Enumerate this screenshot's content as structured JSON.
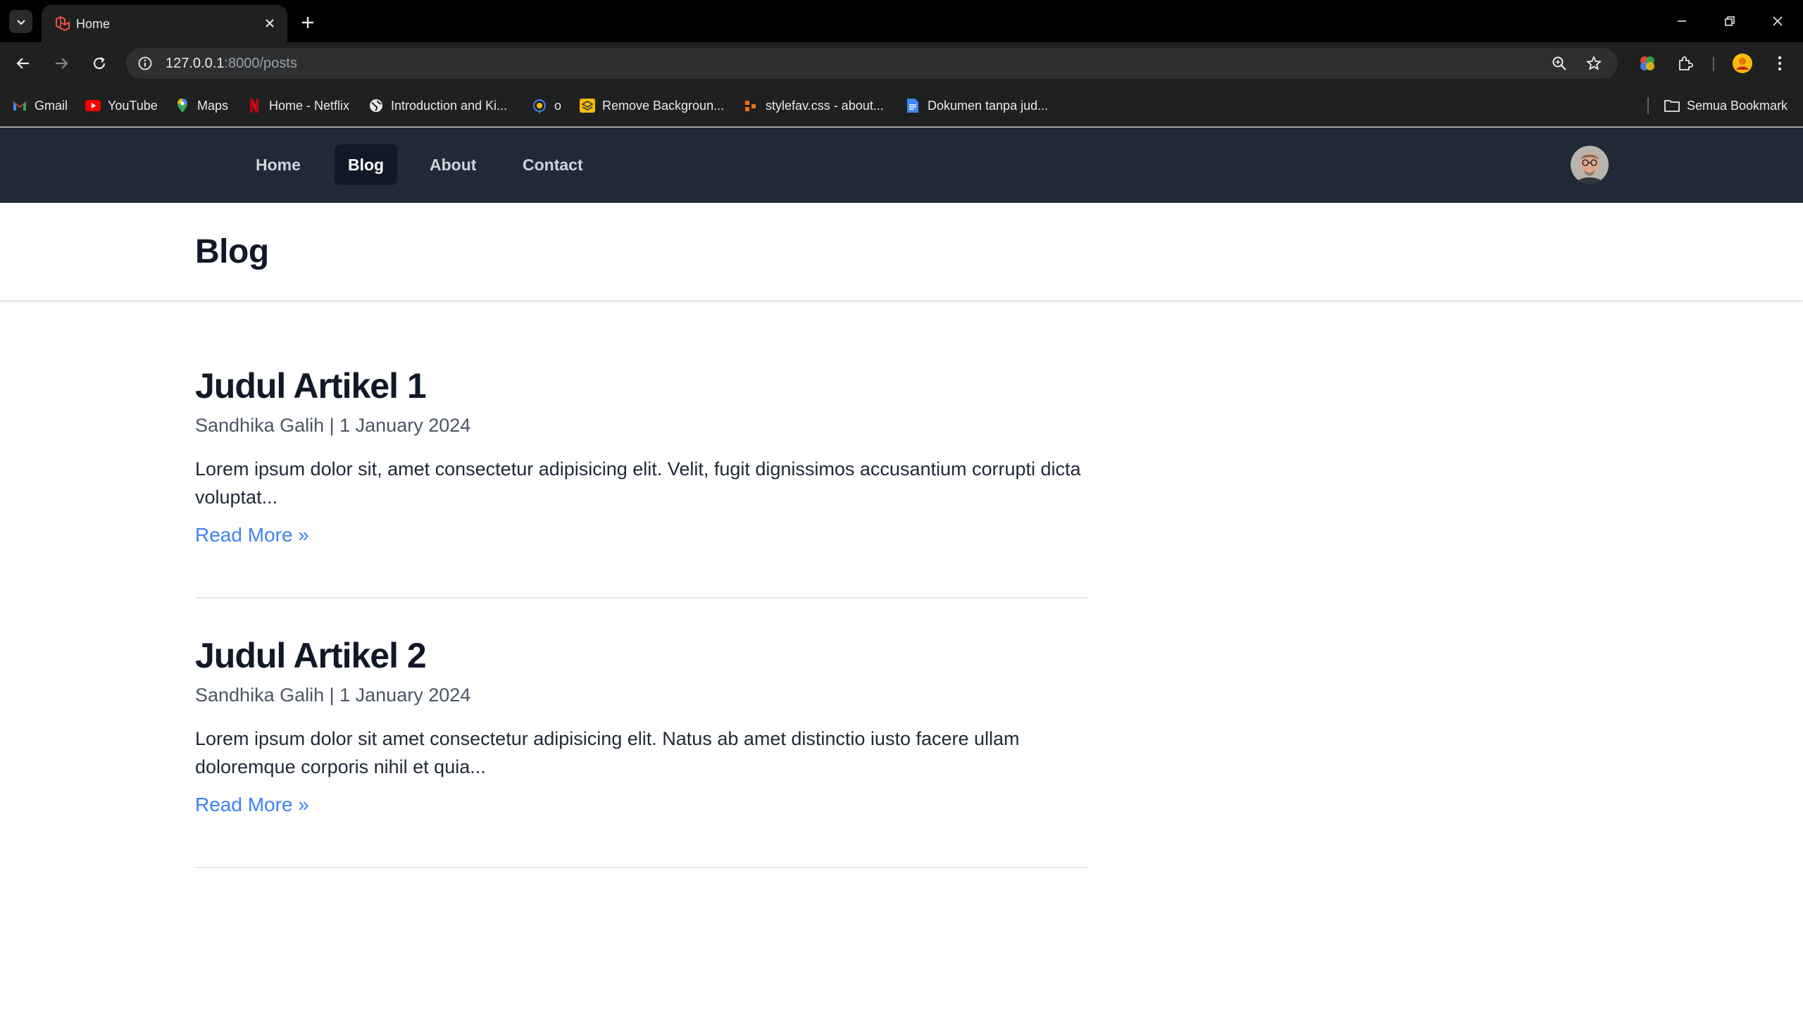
{
  "browser": {
    "tab": {
      "title": "Home"
    },
    "address_bar": {
      "host": "127.0.0.1",
      "rest": ":8000/posts"
    },
    "bookmarks": [
      {
        "label": "Gmail",
        "icon": "gmail-icon"
      },
      {
        "label": "YouTube",
        "icon": "youtube-icon"
      },
      {
        "label": "Maps",
        "icon": "maps-icon"
      },
      {
        "label": "Home - Netflix",
        "icon": "netflix-icon"
      },
      {
        "label": "Introduction and Ki...",
        "icon": "globe-icon"
      },
      {
        "label": "o",
        "icon": "site-icon"
      },
      {
        "label": "Remove Backgroun...",
        "icon": "remove-bg-icon"
      },
      {
        "label": "stylefav.css - about...",
        "icon": "code-icon"
      },
      {
        "label": "Dokumen tanpa jud...",
        "icon": "docs-icon"
      }
    ],
    "all_bookmarks": "Semua Bookmark"
  },
  "nav": {
    "links": [
      {
        "label": "Home",
        "active": false
      },
      {
        "label": "Blog",
        "active": true
      },
      {
        "label": "About",
        "active": false
      },
      {
        "label": "Contact",
        "active": false
      }
    ]
  },
  "page": {
    "title": "Blog"
  },
  "posts": [
    {
      "title": "Judul Artikel 1",
      "meta": "Sandhika Galih | 1 January 2024",
      "excerpt": "Lorem ipsum dolor sit, amet consectetur adipisicing elit. Velit, fugit dignissimos accusantium corrupti dicta voluptat...",
      "read_more": "Read More »"
    },
    {
      "title": "Judul Artikel 2",
      "meta": "Sandhika Galih | 1 January 2024",
      "excerpt": "Lorem ipsum dolor sit amet consectetur adipisicing elit. Natus ab amet distinctio iusto facere ullam doloremque corporis nihil et quia...",
      "read_more": "Read More »"
    }
  ],
  "colors": {
    "navbar": "#1f2937",
    "nav_active": "#111827",
    "link": "#3b82f6",
    "heading": "#111827"
  }
}
